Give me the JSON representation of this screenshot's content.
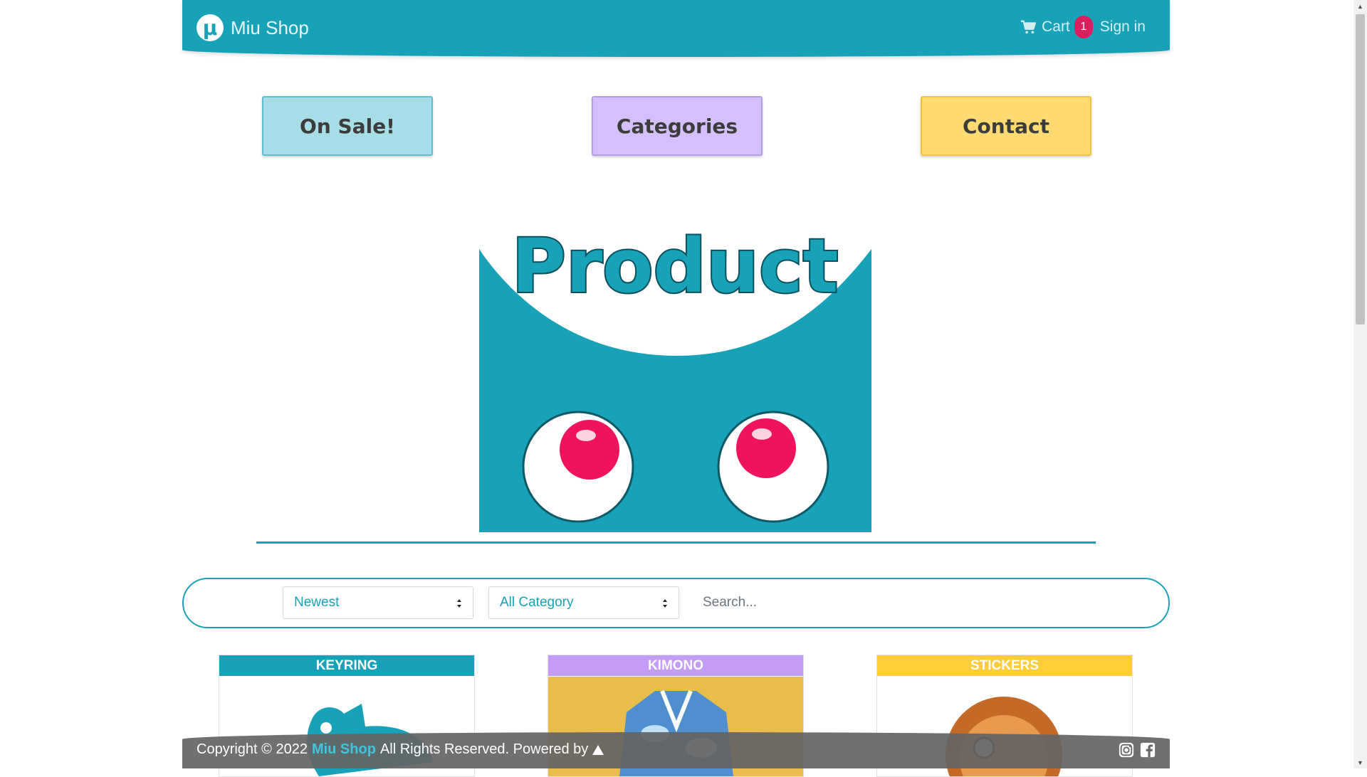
{
  "navbar": {
    "brand_logo": "μ",
    "brand_name": "Miu Shop",
    "cart_label": "Cart",
    "cart_count": "1",
    "signin_label": "Sign in"
  },
  "top_buttons": {
    "sale": "On Sale!",
    "categories": "Categories",
    "contact": "Contact"
  },
  "hero": {
    "word": "Product"
  },
  "filters": {
    "sort_selected": "Newest",
    "category_selected": "All Category",
    "search_placeholder": "Search..."
  },
  "products": [
    {
      "label": "KEYRING",
      "color": "#17a2b8"
    },
    {
      "label": "KIMONO",
      "color": "#c49cf8"
    },
    {
      "label": "STICKERS",
      "color": "#ffcc3a"
    }
  ],
  "footer": {
    "copyright_prefix": "Copyright © 2022",
    "brand": "Miu Shop",
    "copyright_suffix": "All Rights Reserved. Powered by"
  },
  "colors": {
    "primary": "#17a2b8",
    "badge": "#dc1e60",
    "purple": "#c49cf8",
    "yellow": "#ffcc3a"
  },
  "icons": [
    "cart-icon",
    "instagram-icon",
    "facebook-icon",
    "powered-by-icon",
    "caret-icon"
  ]
}
